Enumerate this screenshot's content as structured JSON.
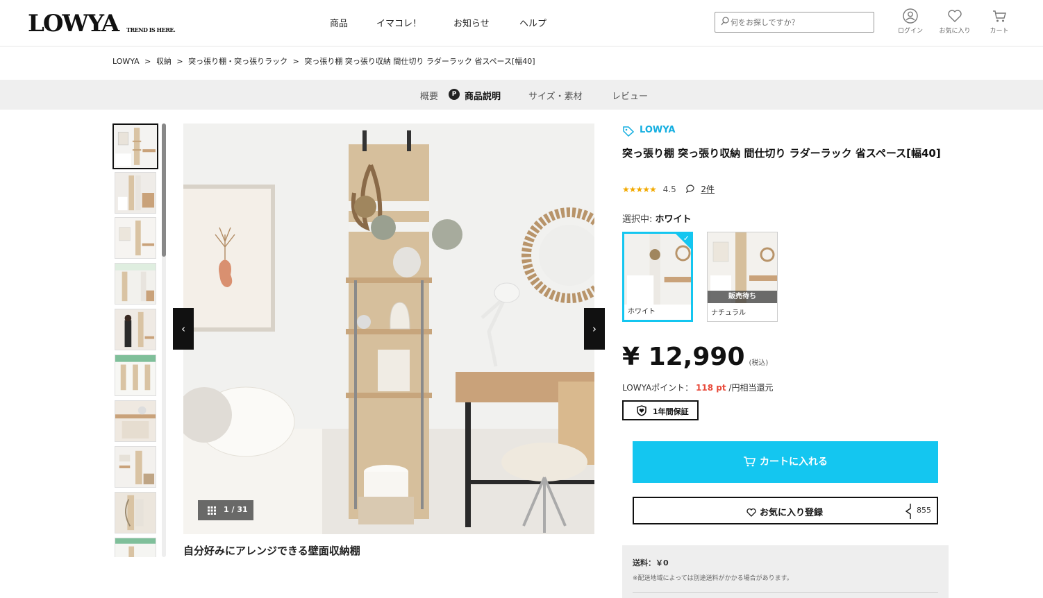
{
  "header": {
    "logo": "LOWYA",
    "tagline": "TREND IS HERE.",
    "nav": [
      "商品",
      "イマコレ！",
      "お知らせ",
      "ヘルプ"
    ],
    "search_placeholder": "何をお探しですか？",
    "icons": [
      {
        "name": "user-icon",
        "label": "ログイン"
      },
      {
        "name": "heart-icon",
        "label": "お気に入り"
      },
      {
        "name": "cart-icon",
        "label": "カート"
      }
    ]
  },
  "breadcrumb": [
    "LOWYA",
    ">",
    "収納",
    ">",
    "突っ張り棚・突っ張りラック",
    ">",
    "突っ張り棚 突っ張り収納 間仕切り ラダーラック 省スペース[幅40]"
  ],
  "tabs": {
    "items": [
      "概要",
      "商品説明",
      "サイズ・素材",
      "レビュー"
    ],
    "active": "商品説明",
    "badge": "P"
  },
  "gallery": {
    "counter": "1 / 31",
    "caption": "自分好みにアレンジできる壁面収納棚",
    "prev": "‹",
    "next": "›"
  },
  "product": {
    "brand": "LOWYA",
    "title": "突っ張り棚 突っ張り収納 間仕切り ラダーラック 省スペース[幅40]",
    "stars": "★★★★★",
    "rating": "4.5",
    "reviews": "2件",
    "selected_label": "選択中:",
    "selected_value": "ホワイト",
    "variants": [
      {
        "name": "ホワイト",
        "selected": true,
        "soldout": ""
      },
      {
        "name": "ナチュラル",
        "selected": false,
        "soldout": "販売待ち"
      }
    ],
    "price": "¥ 12,990",
    "tax": "(税込)",
    "points_label": "LOWYAポイント：",
    "points_value": "118 pt",
    "points_suffix": "/円相当還元",
    "warranty": "1年間保証",
    "cart_button": "カートに入れる",
    "fav_button": "お気に入り登録",
    "fav_count": "855",
    "shipping_fee": "送料：￥0",
    "shipping_note": "※配送地域によっては別途送料がかかる場合があります。"
  },
  "colors": {
    "accent": "#14c6f0",
    "brand_link": "#14aee0",
    "points": "#e84a3a",
    "star": "#f2a900"
  }
}
